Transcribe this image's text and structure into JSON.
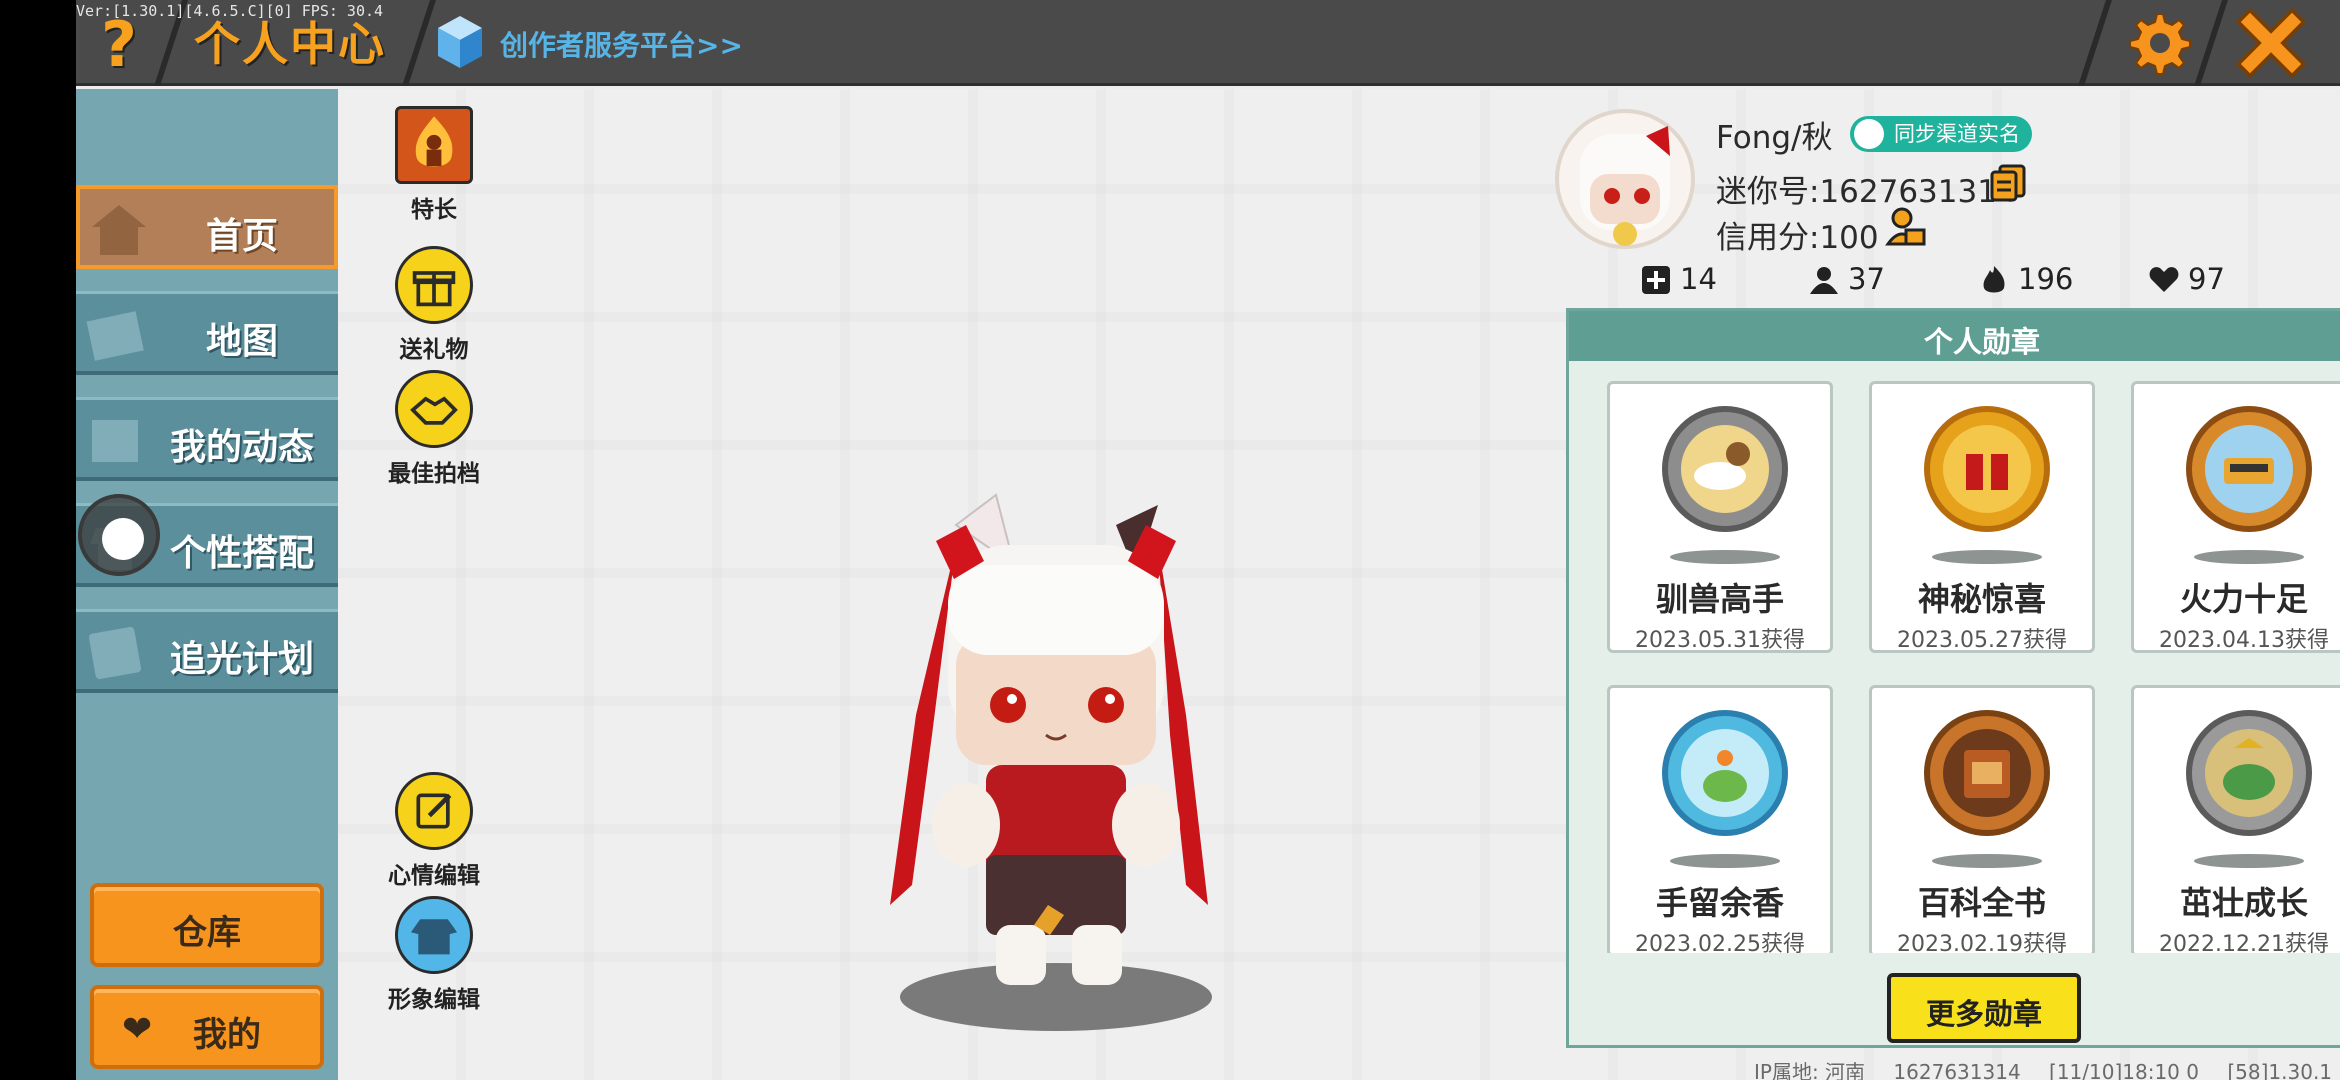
{
  "debug_overlay": "Ver:[1.30.1][4.6.5.C][0] FPS: 30.4",
  "header": {
    "title": "个人中心",
    "creator_link": "创作者服务平台>>",
    "help_icon": "question-icon",
    "settings_icon": "gear-icon",
    "close_icon": "close-icon"
  },
  "sidebar": {
    "items": [
      {
        "label": "首页",
        "icon": "home-icon",
        "active": true
      },
      {
        "label": "地图",
        "icon": "map-icon"
      },
      {
        "label": "我的动态",
        "icon": "feed-icon"
      },
      {
        "label": "个性搭配",
        "icon": "outfit-icon"
      },
      {
        "label": "追光计划",
        "icon": "plan-icon"
      }
    ],
    "warehouse_label": "仓库",
    "mine_label": "我的"
  },
  "tools": {
    "specialty": "特长",
    "send_gift": "送礼物",
    "best_partner": "最佳拍档",
    "mood_edit": "心情编辑",
    "image_edit": "形象编辑"
  },
  "profile": {
    "username": "Fong/秋",
    "sync_badge": "同步渠道实名",
    "mini_id": "迷你号:1627631314",
    "credit": "信用分:100",
    "stats": {
      "friends": "14",
      "followers": "37",
      "popularity": "196",
      "likes": "97"
    }
  },
  "medals": {
    "title": "个人勋章",
    "items": [
      {
        "name": "驯兽高手",
        "date": "2023.05.31获得"
      },
      {
        "name": "神秘惊喜",
        "date": "2023.05.27获得"
      },
      {
        "name": "火力十足",
        "date": "2023.04.13获得"
      },
      {
        "name": "手留余香",
        "date": "2023.02.25获得"
      },
      {
        "name": "百科全书",
        "date": "2023.02.19获得"
      },
      {
        "name": "茁壮成长",
        "date": "2022.12.21获得"
      }
    ],
    "more_label": "更多勋章"
  },
  "footer": {
    "ip": "IP属地: 河南",
    "id": "1627631314",
    "time": "[11/10]18:10 0",
    "version": "[58]1.30.1"
  },
  "colors": {
    "accent_orange": "#f7941d",
    "sidebar_teal": "#5c8f9c",
    "medal_green": "#5e9e93",
    "button_yellow": "#f8e11a"
  }
}
